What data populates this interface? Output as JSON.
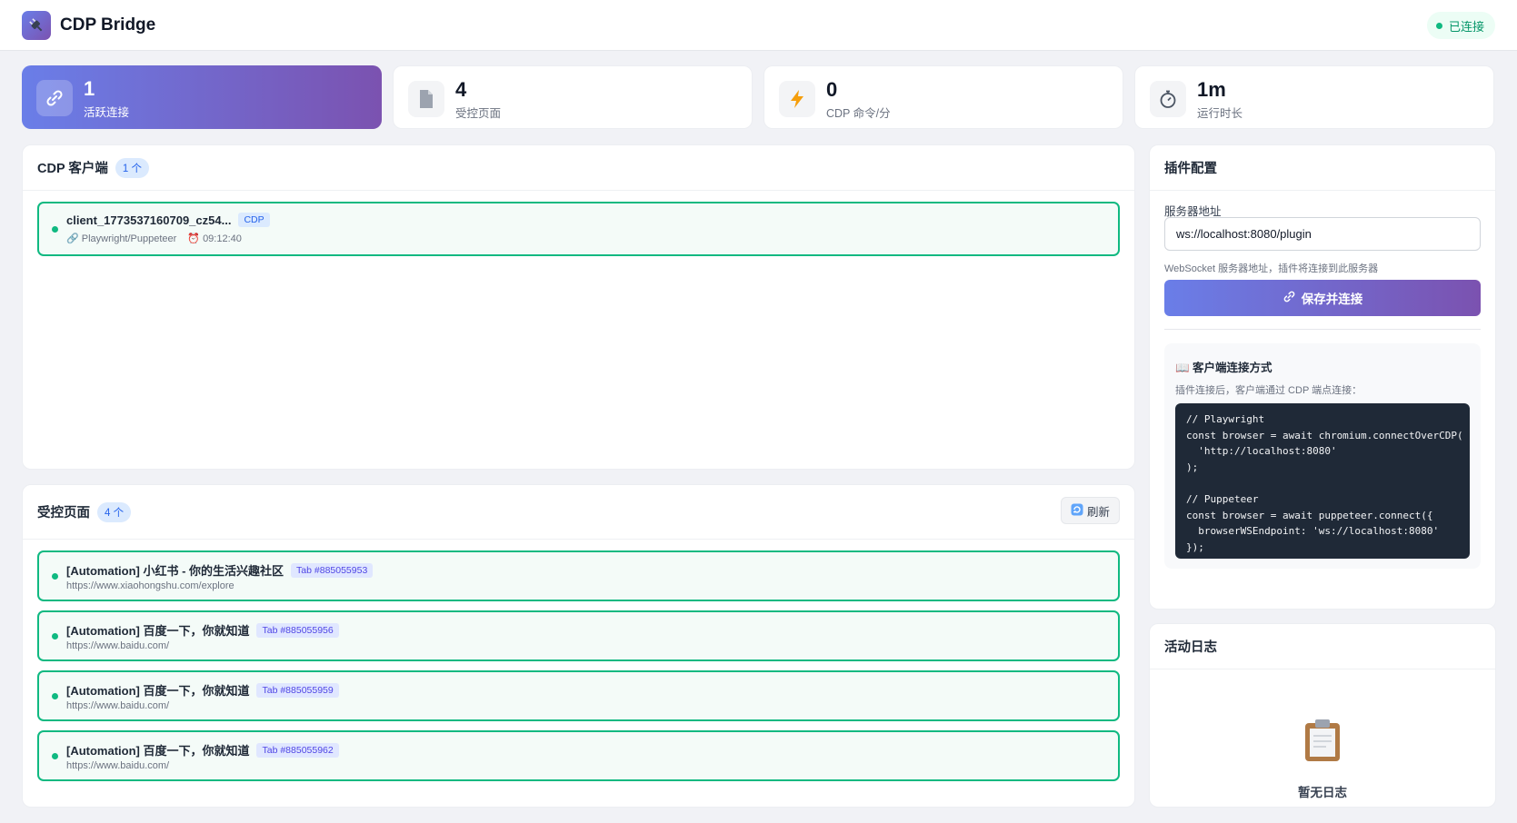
{
  "app": {
    "title": "CDP Bridge",
    "status": "已连接"
  },
  "stats": [
    {
      "icon": "link-icon",
      "value": "1",
      "label": "活跃连接"
    },
    {
      "icon": "page-icon",
      "value": "4",
      "label": "受控页面"
    },
    {
      "icon": "lightning-icon",
      "value": "0",
      "label": "CDP 命令/分"
    },
    {
      "icon": "stopwatch-icon",
      "value": "1m",
      "label": "运行时长"
    }
  ],
  "clients": {
    "title": "CDP 客户端",
    "count": "1 个",
    "items": [
      {
        "id": "client_1773537160709_cz54...",
        "tag": "CDP",
        "type": "🔗 Playwright/Puppeteer",
        "time": "⏰ 09:12:40"
      }
    ]
  },
  "pages": {
    "title": "受控页面",
    "count": "4 个",
    "refresh": "刷新",
    "items": [
      {
        "title": "[Automation] 小红书 - 你的生活兴趣社区",
        "tab": "Tab #885055953",
        "url": "https://www.xiaohongshu.com/explore"
      },
      {
        "title": "[Automation] 百度一下，你就知道",
        "tab": "Tab #885055956",
        "url": "https://www.baidu.com/"
      },
      {
        "title": "[Automation] 百度一下，你就知道",
        "tab": "Tab #885055959",
        "url": "https://www.baidu.com/"
      },
      {
        "title": "[Automation] 百度一下，你就知道",
        "tab": "Tab #885055962",
        "url": "https://www.baidu.com/"
      }
    ]
  },
  "config": {
    "title": "插件配置",
    "server_label": "服务器地址",
    "server_value": "ws://localhost:8080/plugin",
    "server_hint": "WebSocket 服务器地址，插件将连接到此服务器",
    "save_label": "保存并连接",
    "guide_title": "📖 客户端连接方式",
    "guide_desc": "插件连接后，客户端通过 CDP 端点连接：",
    "code": "// Playwright\nconst browser = await chromium.connectOverCDP(\n  'http://localhost:8080'\n);\n\n// Puppeteer\nconst browser = await puppeteer.connect({\n  browserWSEndpoint: 'ws://localhost:8080'\n});"
  },
  "log": {
    "title": "活动日志",
    "empty": "暂无日志"
  },
  "colors": {
    "accent_start": "#6a7ee8",
    "accent_end": "#7b52b0",
    "success": "#10b981"
  }
}
